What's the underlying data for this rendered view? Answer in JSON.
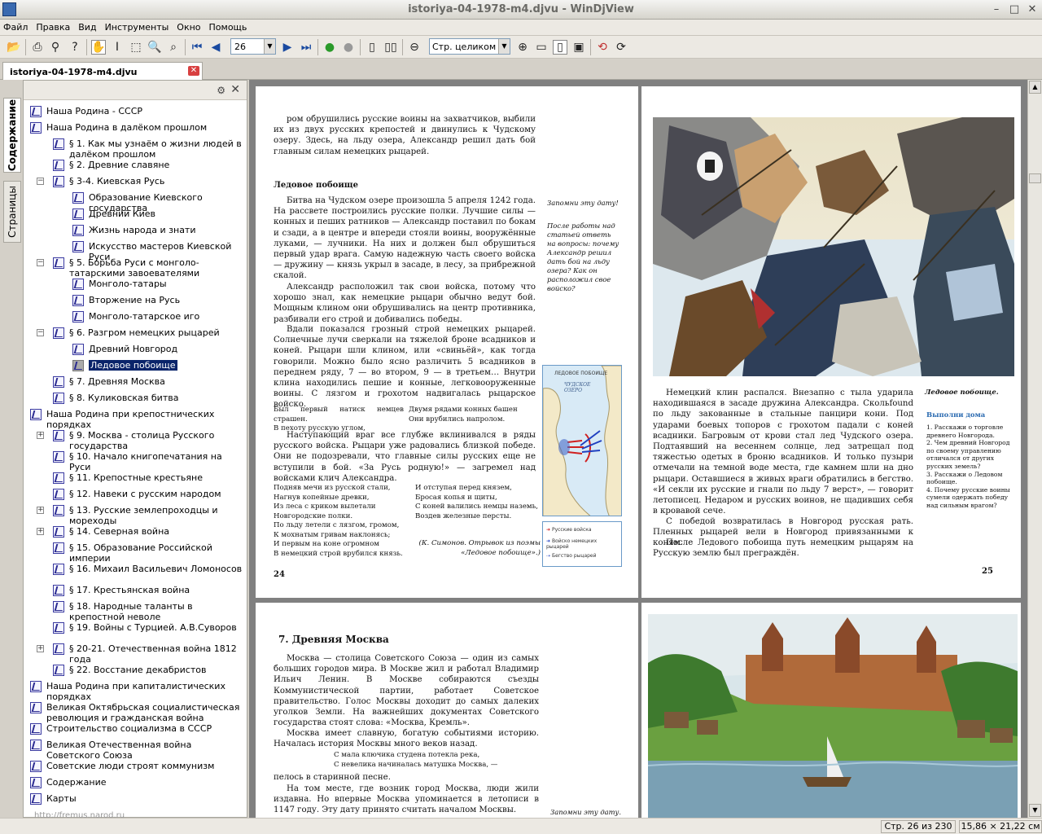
{
  "window": {
    "title": "istoriya-04-1978-m4.djvu - WinDjView"
  },
  "menu": [
    "Файл",
    "Правка",
    "Вид",
    "Инструменты",
    "Окно",
    "Помощь"
  ],
  "toolbar": {
    "page_value": "26",
    "zoom_value": "Стр. целиком"
  },
  "tab": {
    "label": "istoriya-04-1978-m4.djvu"
  },
  "sidebar": {
    "tabs": [
      "Содержание",
      "Страницы"
    ],
    "tree": [
      {
        "label": "Наша Родина - СССР",
        "level": 0,
        "expander": ""
      },
      {
        "label": "Наша Родина в далёком прошлом",
        "level": 0,
        "expander": "-"
      },
      {
        "label": "§ 1. Как мы узнаём о жизни людей в далёком прошлом",
        "level": 1,
        "expander": ""
      },
      {
        "label": "§ 2. Древние славяне",
        "level": 1,
        "expander": ""
      },
      {
        "label": "§ 3-4. Киевская Русь",
        "level": 1,
        "expander": "-"
      },
      {
        "label": "Образование Киевского государства",
        "level": 2,
        "expander": ""
      },
      {
        "label": "Древний Киев",
        "level": 2,
        "expander": ""
      },
      {
        "label": "Жизнь народа и знати",
        "level": 2,
        "expander": ""
      },
      {
        "label": "Искусство мастеров Киевской Руси",
        "level": 2,
        "expander": ""
      },
      {
        "label": "§ 5. Борьба Руси с монголо-татарскими завоевателями",
        "level": 1,
        "expander": "-"
      },
      {
        "label": "Монголо-татары",
        "level": 2,
        "expander": ""
      },
      {
        "label": "Вторжение на Русь",
        "level": 2,
        "expander": ""
      },
      {
        "label": "Монголо-татарское иго",
        "level": 2,
        "expander": ""
      },
      {
        "label": "§ 6. Разгром немецких рыцарей",
        "level": 1,
        "expander": "-"
      },
      {
        "label": "Древний Новгород",
        "level": 2,
        "expander": ""
      },
      {
        "label": "Ледовое побоище",
        "level": 2,
        "expander": "",
        "selected": true
      },
      {
        "label": "§ 7. Древняя Москва",
        "level": 1,
        "expander": ""
      },
      {
        "label": "§ 8. Куликовская битва",
        "level": 1,
        "expander": ""
      },
      {
        "label": "Наша Родина при крепостнических порядках",
        "level": 0,
        "expander": "-"
      },
      {
        "label": "§ 9. Москва - столица Русского государства",
        "level": 1,
        "expander": "+"
      },
      {
        "label": "§ 10. Начало книгопечатания на Руси",
        "level": 1,
        "expander": ""
      },
      {
        "label": "§ 11. Крепостные крестьяне",
        "level": 1,
        "expander": ""
      },
      {
        "label": "§ 12. Навеки с русским народом",
        "level": 1,
        "expander": ""
      },
      {
        "label": "§ 13. Русские землепроходцы и мореходы",
        "level": 1,
        "expander": "+"
      },
      {
        "label": "§ 14. Северная война",
        "level": 1,
        "expander": "+"
      },
      {
        "label": "§ 15. Образование Российской империи",
        "level": 1,
        "expander": ""
      },
      {
        "label": "§ 16. Михаил Васильевич Ломоносов",
        "level": 1,
        "expander": ""
      },
      {
        "label": "§ 17. Крестьянская война",
        "level": 1,
        "expander": ""
      },
      {
        "label": "§ 18. Народные таланты в крепостной неволе",
        "level": 1,
        "expander": ""
      },
      {
        "label": "§ 19. Войны с Турцией. А.В.Суворов",
        "level": 1,
        "expander": ""
      },
      {
        "label": "§ 20-21. Отечественная война 1812 года",
        "level": 1,
        "expander": "+"
      },
      {
        "label": "§ 22. Восстание декабристов",
        "level": 1,
        "expander": ""
      },
      {
        "label": "Наша Родина при капиталистических порядках",
        "level": 0,
        "expander": "+"
      },
      {
        "label": "Великая Октябрьская социалистическая революция и гражданская война",
        "level": 0,
        "expander": "+"
      },
      {
        "label": "Строительство социализма в СССР",
        "level": 0,
        "expander": "+"
      },
      {
        "label": "Великая Отечественная война Советского Союза",
        "level": 0,
        "expander": "+"
      },
      {
        "label": "Советские люди строят коммунизм",
        "level": 0,
        "expander": "+"
      },
      {
        "label": "Содержание",
        "level": 0,
        "expander": ""
      },
      {
        "label": "Карты",
        "level": 0,
        "expander": ""
      }
    ],
    "footer_link": "http://fremus.narod.ru"
  },
  "pages": {
    "p24": {
      "top_text": "ром обрушились русские воины на захватчиков, выбили их из двух русских крепостей и двинулись к Чудскому озеру. Здесь, на льду озера, Александр решил дать бой главным силам немецких рыцарей.",
      "heading": "Ледовое побоище",
      "para1": "Битва на Чудском озере произошла 5 апреля 1242 года. На рассвете построились русские полки. Лучшие силы — конных и пеших ратников — Александр поставил по бокам и сзади, а в центре и впереди стояли воины, вооружённые луками, — лучники. На них и должен был обрушиться первый удар врага. Самую надежную часть своего войска — дружину — князь укрыл в засаде, в лесу, за прибрежной скалой.",
      "para2": "Александр расположил так свои войска, потому что хорошо знал, как немецкие рыцари обычно ведут бой. Мощным клином они обрушивались на центр противника, разбивали его строй и добивались победы.",
      "para3": "Вдали показался грозный строй немецких рыцарей. Солнечные лучи сверкали на тяжелой броне всадников и коней. Рыцари шли клином, или «свиньёй», как тогда говорили. Можно было ясно различить 5 всадников в переднем ряду, 7 — во втором, 9 — в третьем… Внутри клина находились пешие и конные, легковооруженные воины. С лязгом и грохотом надвигалась рыцарское войско.",
      "verse_a_left": "Был первый натиск немцев страшен.\nВ пехоту русскую углом,",
      "verse_a_right": "Двумя рядами конных башен\nОни врубились напролом.",
      "para4": "Наступающий враг все глубже вклинивался в ряды русского войска. Рыцари уже радовались близкой победе. Они не подозревали, что главные силы русских еще не вступили в бой. «За Русь родную!» — загремел над войсками клич Александра.",
      "verse_b_left": "Подняв мечи из русской стали,\nНагнув копейные древки,\nИз леса с криком вылетали\nНовгородские полки.\nПо льду летели с лязгом, громом,\nК мохнатым гривам наклонясь;\nИ первым на коне огромном\nВ немецкий строй врубился князь.",
      "verse_b_right": "И отступая перед князем,\nБросая копья и щиты,\nС коней валились немцы наземь,\nВоздев железные персты.",
      "verse_attrib": "(К. Симонов. Отрывок из поэмы «Ледовое побоище».)",
      "side_note1": "Запомни эту дату!",
      "side_note2": "После работы над статьей ответь на вопросы: почему Александр решил дать бой на льду озера? Как он расположил свое войско?",
      "map_title": "ЛЕДОВОЕ ПОБОИЩЕ",
      "map_lake": "ЧУДСКОЕ ОЗЕРО",
      "map_legend": [
        "Русские войска",
        "Войско немецких рыцарей",
        "Бегство рыцарей"
      ],
      "page_number": "24"
    },
    "p25": {
      "text": "Немецкий клин распался. Внезапно с тыла ударила находившаяся в засаде дружина Александра. Скольfound по льду закованные в стальные панцири кони. Под ударами боевых топоров с грохотом падали с коней всадники. Багровым от крови стал лед Чудского озера. Подтаявший на весеннем солнце, лед затрещал под тяжестью одетых в броню всадников. И только пузыри отмечали на темной воде места, где камнем шли на дно рыцари. Оставшиеся в живых враги обратились в бегство. «И секли их русские и гнали по льду 7 верст», — говорит летописец. Недаром и русских воинов, не щадивших себя в кровавой сече.",
      "para2": "С победой возвратилась в Новгород русская рать. Пленных рыцарей вели в Новгород привязанными к коням.",
      "para3": "После Ледового побоища путь немецким рыцарям на Русскую землю был преграждён.",
      "side_title": "Ледовое побоище.",
      "side_hw": "Выполни дома",
      "side_items": "1. Расскажи о торговле древнего Новгорода.\n2. Чем древний Новгород по своему управлению отличался от других русских земель?\n3. Расскажи о Ледовом побоище.\n4. Почему русские воины сумели одержать победу над сильным врагом?",
      "page_number": "25"
    },
    "p26": {
      "heading": "7. Древняя Москва",
      "para1": "Москва — столица Советского Союза — один из самых больших городов мира. В Москве жил и работал Владимир Ильич Ленин. В Москве собираются съезды Коммунистической партии, работает Советское правительство. Голос Москвы доходит до самых далеких уголков Земли. На важнейших документах Советского государства стоят слова: «Москва, Кремль».",
      "para2": "Москва имеет славную, богатую событиями историю. Началась история Москвы много веков назад.",
      "verse": "С мала ключика студена потекла река,\nС невелика начиналась матушка Москва, —",
      "verse_end": "пелось в старинной песне.",
      "para3": "На том месте, где возник город Москва, люди жили издавна. Но впервые Москва упоминается в летописи в 1147 году. Эту дату принято считать началом Москвы.",
      "side_note": "Запомни эту дату."
    }
  },
  "status": {
    "page": "Стр. 26 из 230",
    "size": "15,86 × 21,22 см"
  },
  "colors": {
    "selection": "#0a246a",
    "viewer_bg": "#808080"
  }
}
